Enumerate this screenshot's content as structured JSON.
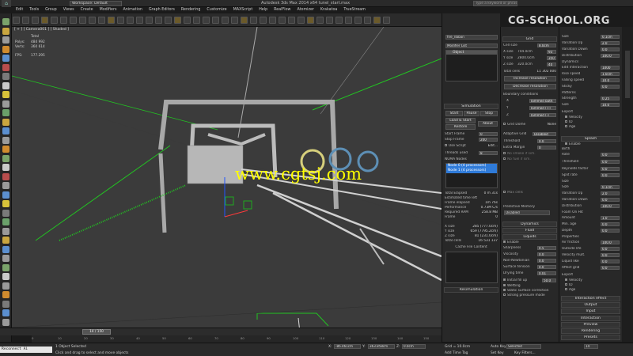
{
  "app": {
    "title": "Autodesk 3ds Max 2014 x64    tunel_start.max",
    "workspace": "Workspace: Default",
    "search_placeholder": "Type a keyword or phrase",
    "channel_logo": "CG-SCHOOL.ORG"
  },
  "menu": [
    "Edit",
    "Tools",
    "Group",
    "Views",
    "Create",
    "Modifiers",
    "Animation",
    "Graph Editors",
    "Rendering",
    "Customize",
    "MAXScript",
    "Help",
    "RealFlow",
    "Atomizer",
    "Krakatoa",
    "TrueStream"
  ],
  "viewport": {
    "label": "[ + ] [ Camera001 ] [ Shaded ]",
    "stats": {
      "total_label": "Total",
      "polys_label": "Polys:",
      "polys": "484 992",
      "verts_label": "Verts:",
      "verts": "360 614",
      "fps_label": "FPS:",
      "fps": "177.295"
    },
    "watermark": "www.cgtsj.com"
  },
  "scroll_strip": {
    "object_name": "fire_ribbon",
    "modifier_list": "Modifier List",
    "modifier_item": "Object",
    "simulation_header": "Simulation",
    "start": "Start",
    "pause": "Pause",
    "stop": "Stop",
    "load_start": "Load & Start",
    "restore": "Restore",
    "about": "About",
    "start_frame_label": "Start Frame",
    "start_frame": "0",
    "stop_frame_label": "Stop Frame",
    "stop_frame": "200",
    "use_script": "Use Script",
    "edit": "Edit...",
    "threads_label": "Threads used",
    "threads": "8",
    "numa_label": "NUMA Nodes",
    "numa": [
      "Node 0 (4 processors)",
      "Node 1 (4 processors)"
    ],
    "total_elapsed_label": "Total Elapsed",
    "total_elapsed": "0 m 31s",
    "estimated_label": "Estimated time left",
    "estimated": "",
    "frame_elapsed_label": "Frame elapsed",
    "frame_elapsed": "1m 76s",
    "performance_label": "Performance",
    "performance": "0.73M C/s",
    "ram_label": "Required RAM",
    "ram": "258.8 MB",
    "frame_label": "Frame",
    "frame": "0",
    "x_size_label": "X size",
    "x_size": "285 (777.0cm)",
    "y_size_label": "Y size",
    "y_size": "659 (7795.2cm)",
    "z_size_label": "Z size",
    "z_size": "81 (231.0cm)",
    "total_cells_label": "Total cells",
    "total_cells": "16 531 137",
    "cache_label": "Cache File Content",
    "resimulation": "Resimulation"
  },
  "command_panel": {
    "grid_header": "Grid",
    "cell_size_label": "Cell size",
    "cell_size": "8.0cm",
    "x_size_label": "X size",
    "x_size": "744.0cm",
    "x_val": "93",
    "y_size_label": "Y size",
    "y_size": "2800.0cm",
    "y_val": "350",
    "z_size_label": "Z size",
    "z_size": "320.0cm",
    "z_val": "40",
    "total_cells_label": "Total cells",
    "total_cells": "11 302 000",
    "increase": "Increase resolution",
    "decrease": "Decrease resolution",
    "boundary_label": "Boundary conditions",
    "x_label": "X",
    "x_bound": "Jammed both",
    "y_label": "Y",
    "y_bound": "Jammed (+)",
    "z_label": "Z",
    "z_bound": "Jammed (-)",
    "grid_dome": "Grid Dome",
    "none": "None",
    "adaptive_grid_label": "Adaptive Grid",
    "adaptive_grid": "Disabled",
    "threshold_label": "Threshold",
    "threshold": "0.0",
    "extra_margin_label": "Extra Margin",
    "extra_margin": "0",
    "no_smoke": "No smoke if sim.",
    "no_fuel": "No fuel if sim.",
    "max_cells": "Max cells",
    "predictive_label": "Predictive Memory",
    "predictive": "Disabled",
    "dynamics": "Dynamics",
    "fluid": "Fluid",
    "liquids": "Liquids",
    "enable": "Enable",
    "sharpness_label": "Sharpness",
    "sharpness": "0.5",
    "viscosity_label": "Viscosity",
    "viscosity": "0.0",
    "non_newtonian_label": "Non-Newtonian",
    "non_newtonian": "0.0",
    "surface_tension_label": "Surface tension",
    "surface_tension": "0.0",
    "drying_label": "Drying time",
    "drying": "0.01",
    "initial_fill": "Initial fill up",
    "initial_fill_val": "50.0",
    "wetting": "Wetting",
    "static_surface": "Static surface correction",
    "strong_pressure": "Strong pressure mode"
  },
  "right_panel": {
    "size_label": "Size",
    "size": "0.1cm",
    "variation_up_label": "Variation Up",
    "variation_up": "2.0",
    "variation_down_label": "Variation Down",
    "variation_down": "0.0",
    "distribution_label": "Distribution",
    "distribution": "100.0",
    "dynamics": "Dynamics",
    "edit_interaction_label": "Edit Interaction",
    "edit_interaction": "1000",
    "rise_speed_label": "Rise speed",
    "rise_speed": "1.0cm",
    "falling_label": "Falling speed",
    "falling": "10.0",
    "sticky_label": "Sticky",
    "sticky": "0.0",
    "patterns": "Patterns",
    "strength_label": "Strength",
    "strength": "0.25",
    "size2_label": "Size",
    "size2": "10.0",
    "export": "Export",
    "velocity": "Velocity",
    "id": "ID",
    "age": "Age",
    "splash_header": "Splash",
    "enable": "Enable",
    "birth": "Birth",
    "rate_label": "Rate",
    "rate": "0.0",
    "threshold_label": "Threshold",
    "threshold": "0.0",
    "reynolds_label": "Reynolds factor",
    "reynolds": "0.0",
    "split_rate_label": "Split rate",
    "split_rate": "0.0",
    "size_head": "Size",
    "size3_label": "Size",
    "size3": "0.1cm",
    "var_up2_label": "Variation Up",
    "var_up2": "2.0",
    "var_down2_label": "Variation Down",
    "var_down2": "0.0",
    "dist2_label": "Distribution",
    "dist2": "100.0",
    "foam_label": "Foam On Hit",
    "amount_label": "Amount",
    "amount": "1.0",
    "min_age_label": "Min. age",
    "min_age": "0.0",
    "depth_label": "Depth",
    "depth": "0.0",
    "properties": "Properties",
    "air_friction_label": "Air friction",
    "air_friction": "100.0",
    "outside_life_label": "Outside life",
    "outside_life": "0.0",
    "velocity_mult_label": "Velocity mult.",
    "velocity_mult": "0.0",
    "liquid_like_label": "Liquid like",
    "liquid_like": "0.0",
    "affect_grid_label": "Affect grid",
    "affect_grid": "0.0",
    "export2": "Export",
    "rollouts": [
      "Interaction effect",
      "Output",
      "Input",
      "Interaction",
      "Preview",
      "Rendering",
      "Presets"
    ]
  },
  "timeline": {
    "slider": "14 / 150",
    "ticks": [
      "0",
      "10",
      "20",
      "30",
      "40",
      "50",
      "60",
      "70",
      "80",
      "90",
      "100",
      "110",
      "120",
      "130",
      "140",
      "150"
    ]
  },
  "status": {
    "maxscript": "Reconnect Ai",
    "selected": "1 Object Selected",
    "prompt": "Click and drag to select and move objects",
    "x_label": "X:",
    "x": "-86.461cm",
    "y_label": "Y:",
    "y": "363.858cm",
    "z_label": "Z:",
    "z": "0.0cm",
    "grid": "Grid = 10.0cm",
    "auto_key": "Auto Key",
    "set_key": "Set Key",
    "selected_dropdown": "Selected",
    "key_filters": "Key Filters...",
    "add_time_tag": "Add Time Tag",
    "frame": "14"
  }
}
